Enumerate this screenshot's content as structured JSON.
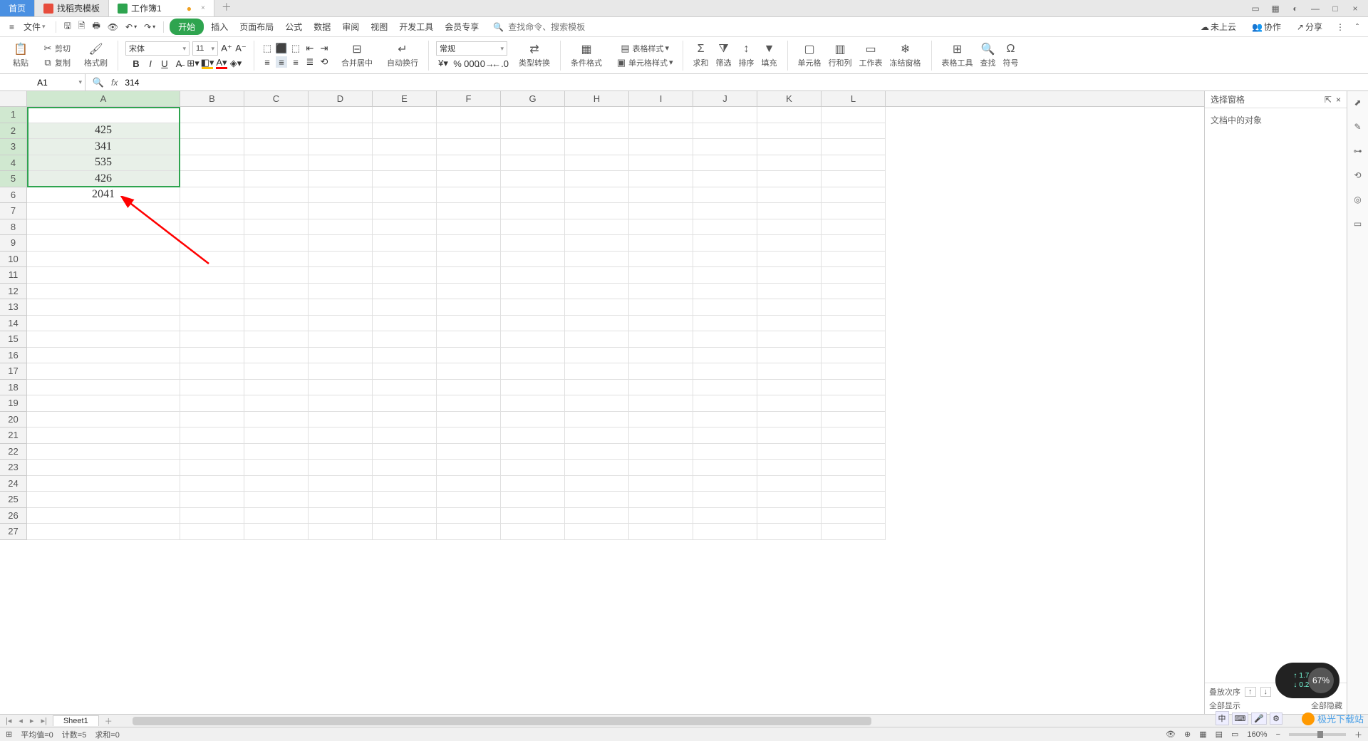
{
  "titlebar": {
    "tabs": [
      {
        "label": "首页"
      },
      {
        "label": "找稻壳模板"
      },
      {
        "label": "工作簿1",
        "modified": true
      }
    ]
  },
  "window_controls": {
    "min": "—",
    "max": "□",
    "close": "×"
  },
  "menu": {
    "file": "文件",
    "items": [
      "开始",
      "插入",
      "页面布局",
      "公式",
      "数据",
      "审阅",
      "视图",
      "开发工具",
      "会员专享"
    ],
    "search_placeholder": "查找命令、搜索模板",
    "search_icon_label": "Q",
    "right": {
      "cloud": "未上云",
      "collab": "协作",
      "share": "分享"
    }
  },
  "ribbon": {
    "paste": "粘贴",
    "cut": "剪切",
    "copy": "复制",
    "format_painter": "格式刷",
    "font_name": "宋体",
    "font_size": "11",
    "merge": "合并居中",
    "wrap": "自动换行",
    "number_format": "常规",
    "type_convert": "类型转换",
    "cond_fmt": "条件格式",
    "cell_style": "单元格样式",
    "table_style": "表格样式",
    "sum": "求和",
    "filter": "筛选",
    "sort": "排序",
    "fill": "填充",
    "cells": "单元格",
    "rowcol": "行和列",
    "sheet": "工作表",
    "freeze": "冻结窗格",
    "table_tools": "表格工具",
    "find": "查找",
    "symbol": "符号"
  },
  "formula": {
    "cell_ref": "A1",
    "value": "314"
  },
  "grid": {
    "columns": [
      "A",
      "B",
      "C",
      "D",
      "E",
      "F",
      "G",
      "H",
      "I",
      "J",
      "K",
      "L"
    ],
    "col_widths": {
      "A": 215,
      "default": 90
    },
    "row_count": 27,
    "cells": {
      "A1": "314",
      "A2": "425",
      "A3": "341",
      "A4": "535",
      "A5": "426",
      "A6": "2041"
    },
    "selection": {
      "from": "A1",
      "to": "A5"
    },
    "active": "A1"
  },
  "right_pane": {
    "title": "选择窗格",
    "body_text": "文档中的对象",
    "footer": {
      "order": "叠放次序",
      "show_all": "全部显示",
      "hide_all": "全部隐藏"
    }
  },
  "sheets": {
    "active": "Sheet1"
  },
  "status": {
    "avg": "平均值=0",
    "count": "计数=5",
    "sum": "求和=0",
    "zoom": "160%"
  },
  "float": {
    "up_speed": "1.7 K/s",
    "down_speed": "0.2 K/s",
    "pct": "67%"
  },
  "watermark": "极光下载站",
  "ime": {
    "lang": "中"
  }
}
